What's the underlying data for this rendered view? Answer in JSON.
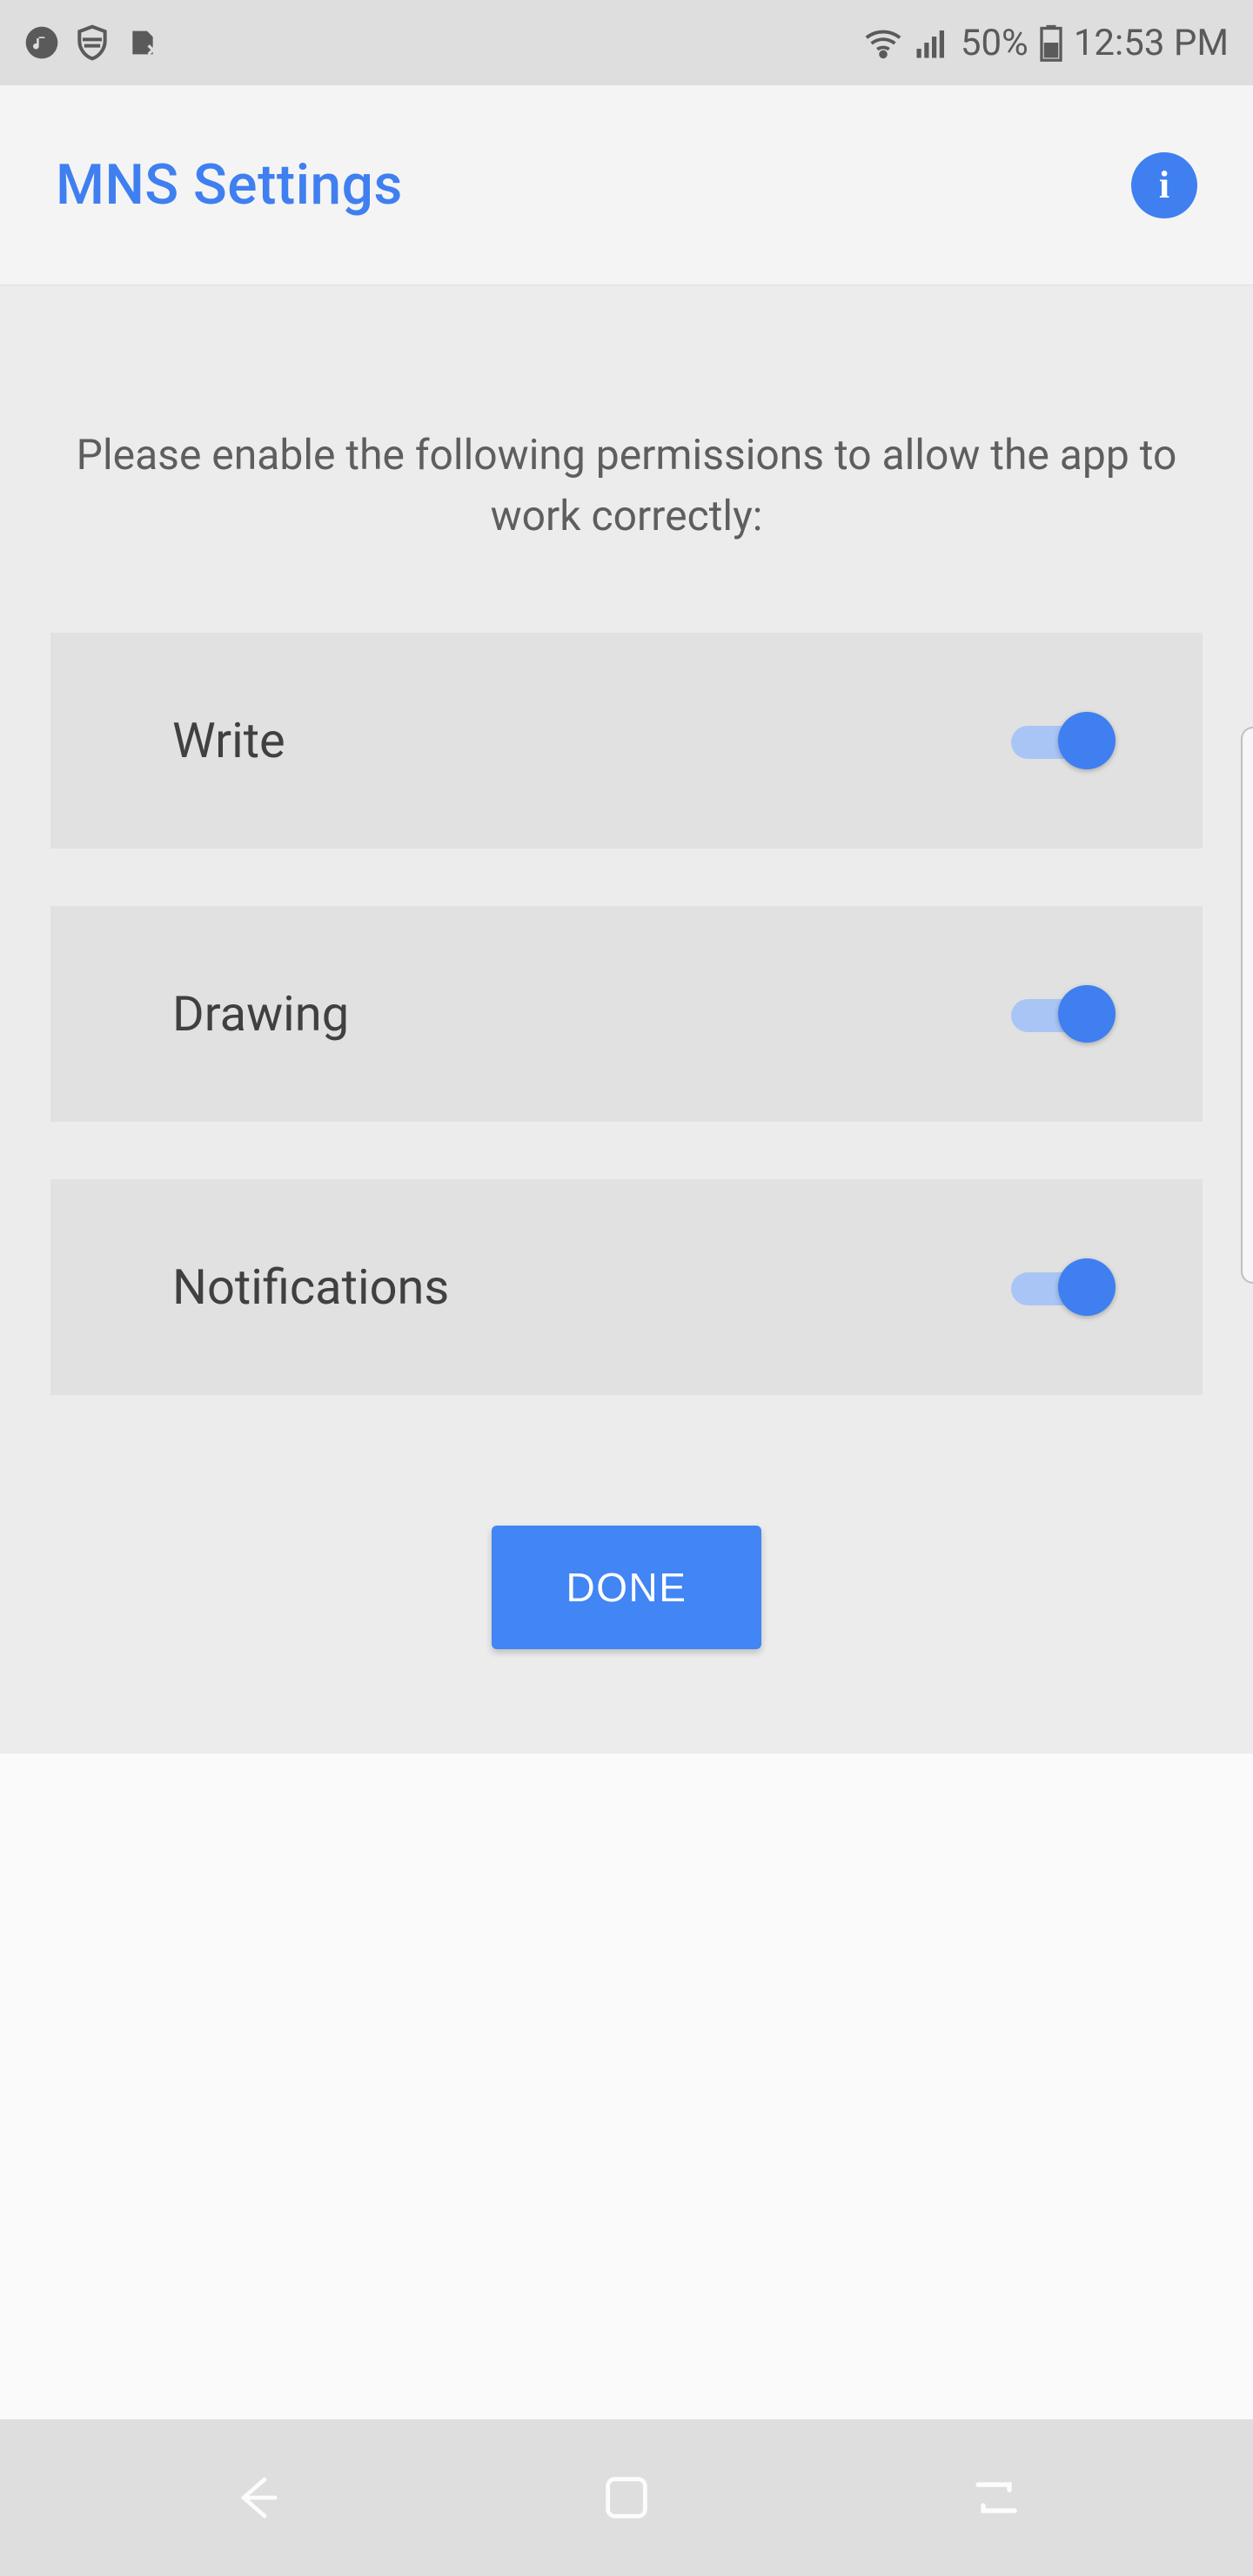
{
  "status_bar": {
    "battery_text": "50%",
    "time": "12:53 PM"
  },
  "app_bar": {
    "title": "MNS Settings"
  },
  "content": {
    "description": "Please enable the following permissions to allow the app to work correctly:",
    "permissions": [
      {
        "label": "Write",
        "enabled": true
      },
      {
        "label": "Drawing",
        "enabled": true
      },
      {
        "label": "Notifications",
        "enabled": true
      }
    ],
    "done_label": "DONE"
  }
}
